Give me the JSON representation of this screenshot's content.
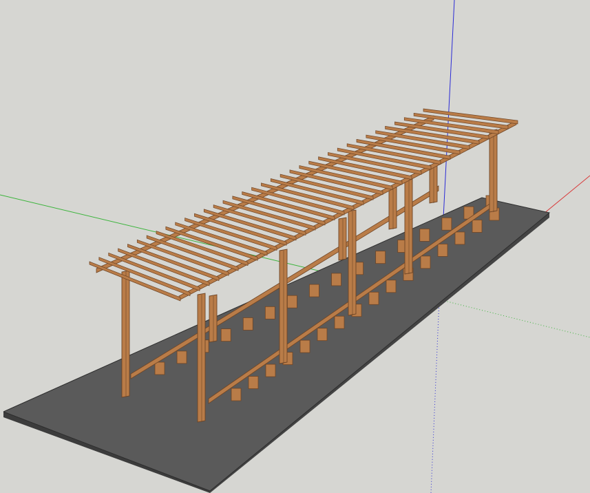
{
  "viewport": {
    "background": "#d6d6d2",
    "axis_colors": {
      "red": "#d93a3a",
      "green": "#3bb43b",
      "blue": "#2a2ad6"
    }
  },
  "model": {
    "floor_slab_color": "#5a5a5a",
    "floor_edge_color": "#3c3c3c",
    "wood_light": "#b97c48",
    "wood_dark": "#6e4526",
    "rafter_count": 36,
    "post_pairs": 5,
    "bench_supports_per_side": 16
  }
}
